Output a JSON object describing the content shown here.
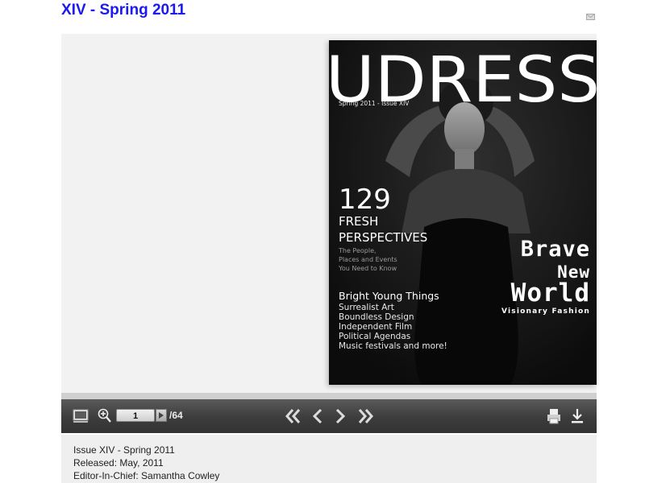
{
  "header": {
    "title": "XIV - Spring 2011",
    "mail_icon": "mail-icon"
  },
  "cover": {
    "masthead": "UDRESS",
    "issue_line": "Spring 2011 - Issue XIV",
    "headline_number": "129",
    "headline_line1": "FRESH",
    "headline_line2": "PERSPECTIVES",
    "subline1": "The People,",
    "subline2": "Places and Events",
    "subline3": "You Need to Know",
    "section_title": "Bright Young Things",
    "section_items": [
      "Surrealist Art",
      "Boundless Design",
      "Independent Film",
      "Political Agendas",
      "Music festivals and more!"
    ],
    "feature_line1": "Brave",
    "feature_line2": "New",
    "feature_line3": "World",
    "feature_sub": "Visionary Fashion"
  },
  "toolbar": {
    "current_page": "1",
    "total_pages": "/64",
    "icons": [
      "thumbnails-icon",
      "zoom-in-icon",
      "go-icon",
      "first-page-icon",
      "previous-page-icon",
      "next-page-icon",
      "last-page-icon",
      "print-icon",
      "download-icon"
    ]
  },
  "info": {
    "issue": "Issue XIV - Spring 2011",
    "released": "Released: May, 2011",
    "editor": "Editor-In-Chief: Samantha Cowley"
  },
  "colors": {
    "title": "#1a1aee",
    "toolbar": "#3c3c3c",
    "cover_bg": "#141414"
  }
}
